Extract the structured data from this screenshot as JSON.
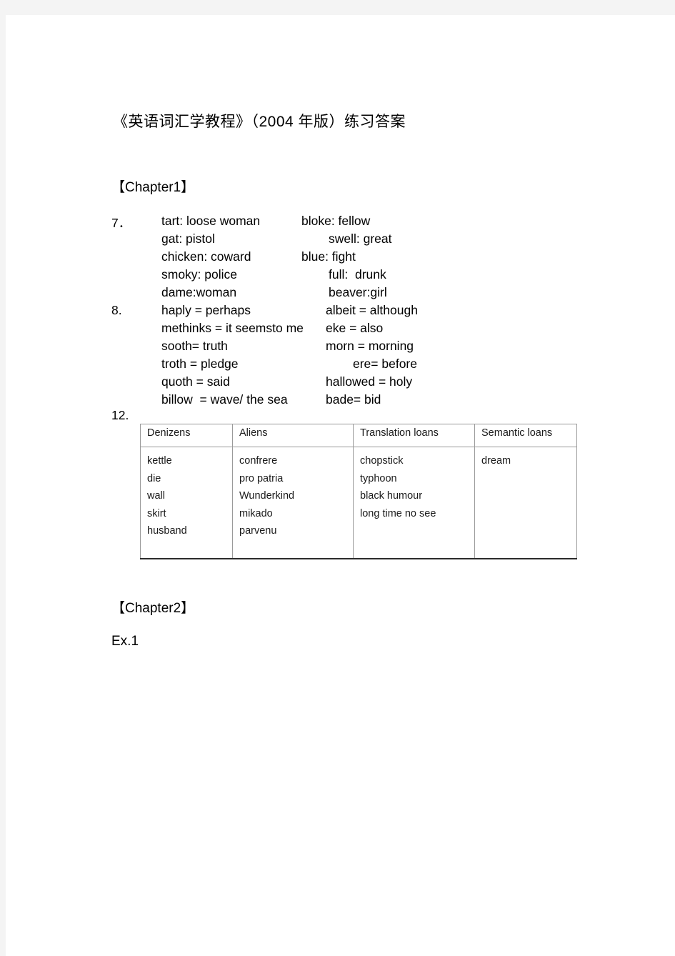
{
  "document": {
    "title": "《英语词汇学教程》（2004 年版）练习答案"
  },
  "chapter1": {
    "heading": "【Chapter1】",
    "exercise7": {
      "number": "7．",
      "rows": [
        {
          "left": "tart: loose woman",
          "right": "bloke: fellow",
          "right_indent": false
        },
        {
          "left": "gat: pistol",
          "right": "swell: great",
          "right_indent": true
        },
        {
          "left": "chicken: coward",
          "right": "blue: fight",
          "right_indent": false
        },
        {
          "left": "smoky: police",
          "right": "full:  drunk",
          "right_indent": true
        },
        {
          "left": "dame:woman",
          "right": "beaver:girl",
          "right_indent": true
        }
      ]
    },
    "exercise8": {
      "number": "8.",
      "rows": [
        {
          "left": "haply = perhaps",
          "right": "albeit = although",
          "right_indent": false
        },
        {
          "left": "methinks = it seemsto me",
          "right": "eke = also",
          "right_indent": false
        },
        {
          "left": "sooth= truth",
          "right": "morn = morning",
          "right_indent": false
        },
        {
          "left": "troth = pledge",
          "right": "ere= before",
          "right_indent": true
        },
        {
          "left": "quoth = said",
          "right": "hallowed = holy",
          "right_indent": false
        },
        {
          "left": "billow  = wave/ the sea",
          "right": "bade= bid",
          "right_indent": false
        }
      ]
    },
    "exercise12": {
      "number": "12.",
      "table": {
        "headers": [
          "Denizens",
          "Aliens",
          "Translation  loans",
          "Semantic  loans"
        ],
        "columns": [
          [
            "kettle",
            "die",
            "wall",
            "skirt",
            "husband"
          ],
          [
            "confrere",
            "pro patria",
            "Wunderkind",
            "mikado",
            "parvenu"
          ],
          [
            "chopstick",
            "typhoon",
            "black humour",
            "long time no see"
          ],
          [
            "dream"
          ]
        ]
      }
    }
  },
  "chapter2": {
    "heading": "【Chapter2】",
    "ex_label": "Ex.1"
  },
  "colors": {
    "page_background": "#ffffff",
    "backdrop": "#f4f4f4",
    "text": "#000000",
    "table_border": "#9a9a9a",
    "table_bottom_rule": "#2b2b2b"
  }
}
